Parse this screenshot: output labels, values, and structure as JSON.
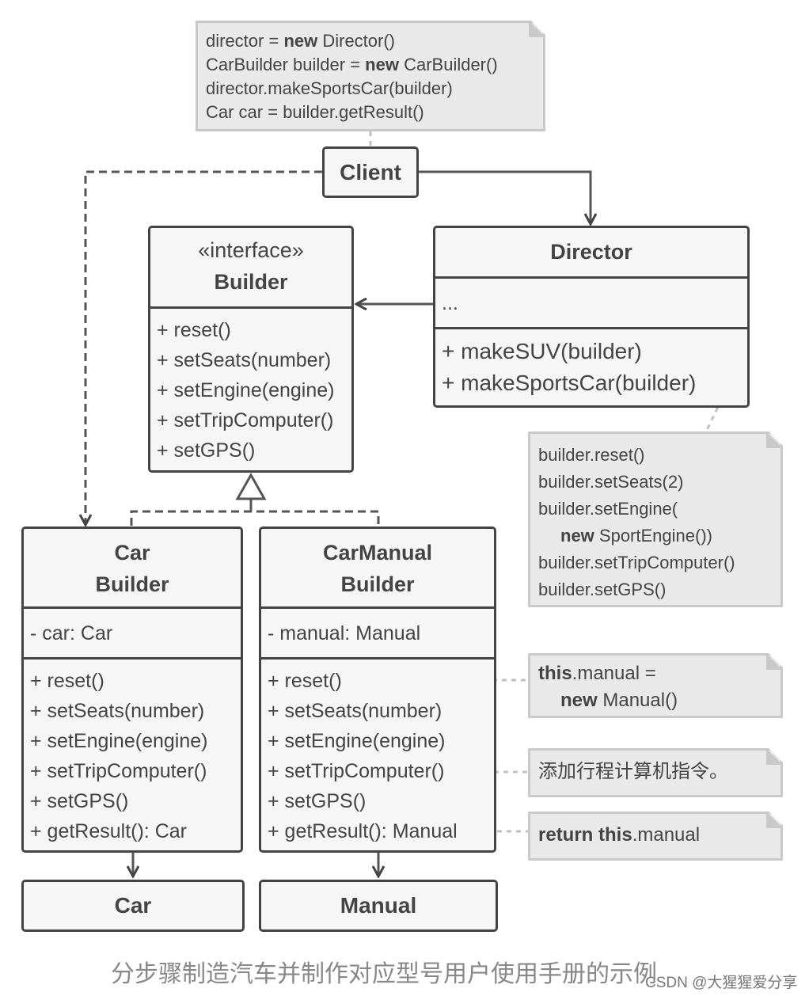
{
  "client": {
    "label": "Client"
  },
  "client_note": {
    "lines": [
      [
        {
          "t": "director = "
        },
        {
          "t": "new",
          "b": true
        },
        {
          "t": " Director()"
        }
      ],
      [
        {
          "t": "CarBuilder builder = "
        },
        {
          "t": "new",
          "b": true
        },
        {
          "t": " CarBuilder()"
        }
      ],
      [
        {
          "t": "director.makeSportsCar(builder)"
        }
      ],
      [
        {
          "t": "Car car = builder.getResult()"
        }
      ]
    ]
  },
  "builder": {
    "stereotype": "«interface»",
    "name": "Builder",
    "methods": [
      "+ reset()",
      "+ setSeats(number)",
      "+ setEngine(engine)",
      "+ setTripComputer()",
      "+ setGPS()"
    ]
  },
  "director": {
    "name": "Director",
    "fields": [
      "..."
    ],
    "methods": [
      "+ makeSUV(builder)",
      "+ makeSportsCar(builder)"
    ]
  },
  "director_note": {
    "lines": [
      "builder.reset()",
      "builder.setSeats(2)",
      "builder.setEngine("
    ],
    "new_kw": "new",
    "new_rest": " SportEngine())",
    "lines2": [
      "builder.setTripComputer()",
      "builder.setGPS()"
    ]
  },
  "car_builder": {
    "name_lines": [
      "Car",
      "Builder"
    ],
    "fields": [
      "- car: Car"
    ],
    "methods": [
      "+ reset()",
      "+ setSeats(number)",
      "+ setEngine(engine)",
      "+ setTripComputer()",
      "+ setGPS()",
      "+ getResult(): Car"
    ]
  },
  "manual_builder": {
    "name_lines": [
      "CarManual",
      "Builder"
    ],
    "fields": [
      "- manual: Manual"
    ],
    "methods": [
      "+ reset()",
      "+ setSeats(number)",
      "+ setEngine(engine)",
      "+ setTripComputer()",
      "+ setGPS()",
      "+ getResult(): Manual"
    ]
  },
  "reset_note": {
    "kw_this": "this",
    "rest1": ".manual =",
    "kw_new": "new",
    "rest2": " Manual()"
  },
  "trip_note": {
    "text": "添加行程计算机指令。"
  },
  "result_note": {
    "kw_return": "return",
    "kw_this": "this",
    "rest": ".manual"
  },
  "car": {
    "label": "Car"
  },
  "manual": {
    "label": "Manual"
  },
  "caption": "分步骤制造汽车并制作对应型号用户使用手册的示例",
  "watermark": "CSDN @大猩猩爱分享",
  "colors": {
    "stroke": "#444444",
    "box_fill": "#f6f6f6",
    "note_fill": "#e9e9e9",
    "note_border": "#c9c9c9",
    "connector": "#c0c0c0"
  }
}
